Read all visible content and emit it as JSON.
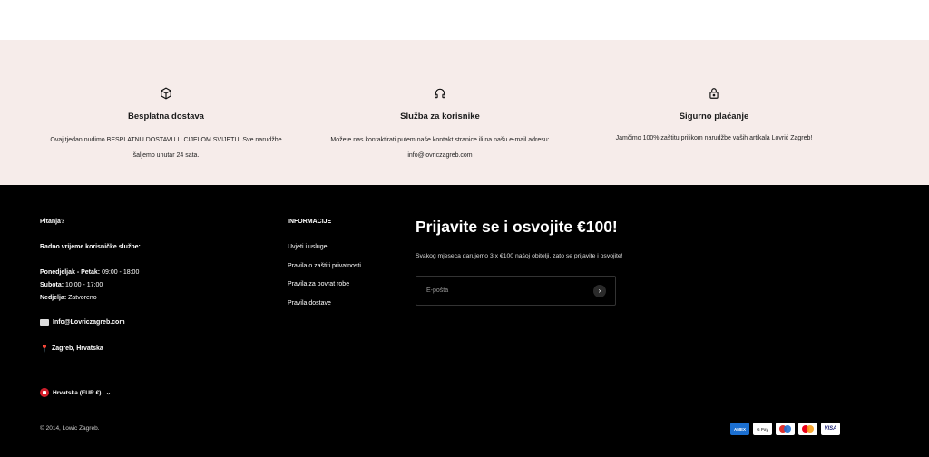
{
  "features": [
    {
      "icon": "box-icon",
      "title": "Besplatna dostava",
      "lines": [
        "Ovaj tjedan nudimo BESPLATNU DOSTAVU U CIJELOM SVIJETU. Sve narudžbe",
        "šaljemo unutar 24 sata."
      ]
    },
    {
      "icon": "headset-icon",
      "title": "Služba za korisnike",
      "lines": [
        "Možete nas kontaktirati putem naše kontakt stranice ili na našu e-mail adresu:",
        "info@lovriczagreb.com"
      ]
    },
    {
      "icon": "lock-icon",
      "title": "Sigurno plaćanje",
      "lines": [
        "Jamčimo 100% zaštitu prilikom narudžbe vaših artikala Lovrić Zagreb!"
      ]
    }
  ],
  "contact": {
    "heading": "Pitanja?",
    "hours_heading": "Radno vrijeme korisničke službe:",
    "hours": [
      {
        "day": "Ponedjeljak - Petak:",
        "time": " 09:00 - 18:00"
      },
      {
        "day": "Subota:",
        "time": " 10:00 - 17:00"
      },
      {
        "day": "Nedjelja:",
        "time": " Zatvoreno"
      }
    ],
    "email": "Info@Lovriczagreb.com",
    "location": "Zagreb, Hrvatska"
  },
  "info": {
    "heading": "INFORMACIJE",
    "links": [
      "Uvjeti i usluge",
      "Pravila o zaštiti privatnosti",
      "Pravila za povrat robe",
      "Pravila dostave"
    ]
  },
  "newsletter": {
    "title": "Prijavite se i osvojite €100!",
    "text": "Svakog mjeseca darujemo 3 x €100 našoj obitelji, zato se prijavite i osvojite!",
    "placeholder": "E-pošta"
  },
  "currency": "Hrvatska (EUR €)",
  "copyright": "© 2014, Lowic Zagreb.",
  "payments": [
    "American Express",
    "Google Pay",
    "Maestro",
    "Mastercard",
    "Visa"
  ]
}
